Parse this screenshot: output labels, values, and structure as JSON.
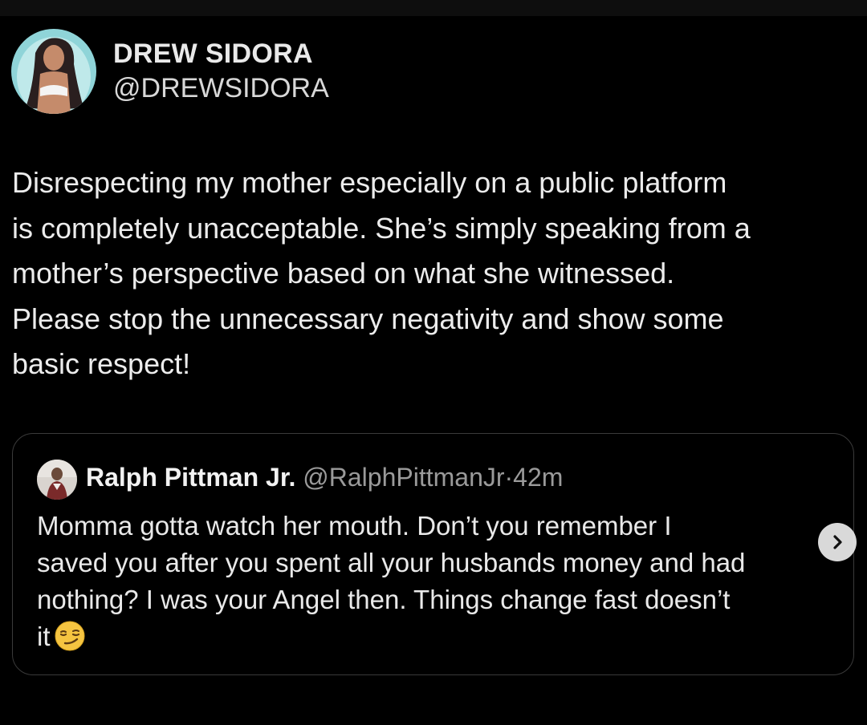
{
  "post": {
    "author_name": "DREW SIDORA",
    "author_handle": "@DREWSIDORA",
    "lines": [
      "Disrespecting my mother especially on a public platform",
      "is completely unacceptable. She’s simply speaking from a",
      "mother’s perspective based on what she witnessed.",
      "Please stop the unnecessary negativity and show some",
      "basic respect!"
    ]
  },
  "quoted_post": {
    "author_name": "Ralph Pittman Jr.",
    "author_handle": "@RalphPittmanJr",
    "separator": "·",
    "time": "42m",
    "lines": [
      "Momma gotta watch her mouth. Don’t you remember I",
      "saved you after you spent all your husbands money and had",
      "nothing? I was your Angel then. Things change fast doesn’t",
      "it"
    ],
    "emoji": "smirking-face-icon"
  },
  "controls": {
    "next_icon": "chevron-right-icon"
  },
  "colors": {
    "background": "#000000",
    "text_primary": "#ececec",
    "text_secondary": "#9a9a9a",
    "card_border": "#3a3a3a",
    "emoji_yellow": "#f5c441"
  }
}
